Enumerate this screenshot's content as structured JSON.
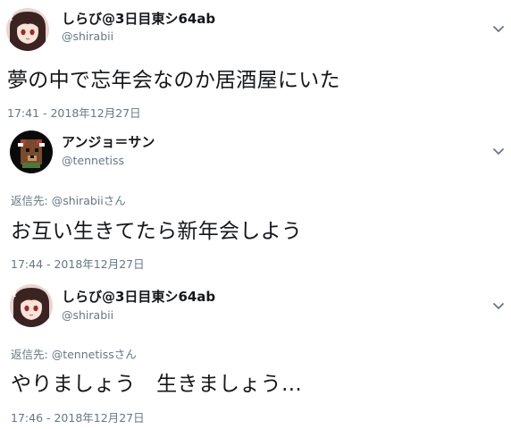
{
  "tweets": [
    {
      "display_name": "しらび@3日目東シ64ab",
      "handle": "@shirabii",
      "text": "夢の中で忘年会なのか居酒屋にいた",
      "timestamp": "17:41 - 2018年12月27日",
      "avatar_icon": "anime-girl-avatar-icon"
    },
    {
      "display_name": "アンジョ＝サン",
      "handle": "@tennetiss",
      "reply_label": "返信先: ",
      "reply_to": "@shirabiiさん",
      "text": "お互い生きてたら新年会しよう",
      "timestamp": "17:44 - 2018年12月27日",
      "avatar_icon": "pixel-bear-avatar-icon"
    },
    {
      "display_name": "しらび@3日目東シ64ab",
      "handle": "@shirabii",
      "reply_label": "返信先: ",
      "reply_to": "@tennetissさん",
      "text": "やりましょう　生きましょう…",
      "timestamp": "17:46 - 2018年12月27日",
      "avatar_icon": "anime-girl-avatar-icon"
    }
  ],
  "colors": {
    "text_primary": "#14171a",
    "text_secondary": "#657786",
    "background": "#ffffff"
  }
}
